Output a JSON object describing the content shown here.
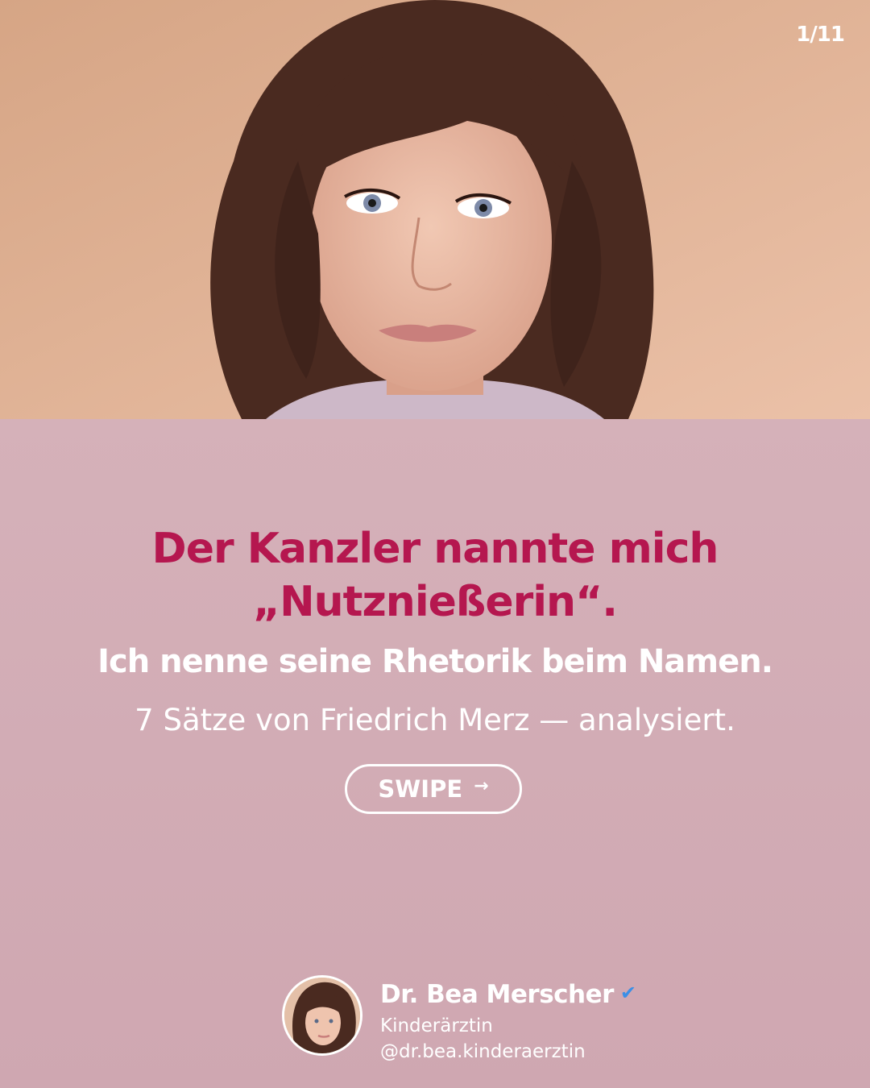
{
  "slide": {
    "page_indicator": "1/11"
  },
  "hero": {
    "photo": "portrait-photo"
  },
  "content": {
    "headline_line1": "Der Kanzler nannte mich",
    "headline_line2": "„Nutznießerin“.",
    "subheadline": "Ich nenne seine Rhetorik beim Namen.",
    "tagline": "7 Sätze von Friedrich Merz — analysiert.",
    "swipe_label": "SWIPE",
    "swipe_arrow": "→"
  },
  "profile": {
    "name": "Dr. Bea Merscher",
    "verified_icon": "✔",
    "role": "Kinderärztin",
    "handle": "@dr.bea.kinderaerztin"
  },
  "colors": {
    "headline": "#b5174f",
    "panel_background": "#d2adb6",
    "verified": "#3c8fe6"
  }
}
